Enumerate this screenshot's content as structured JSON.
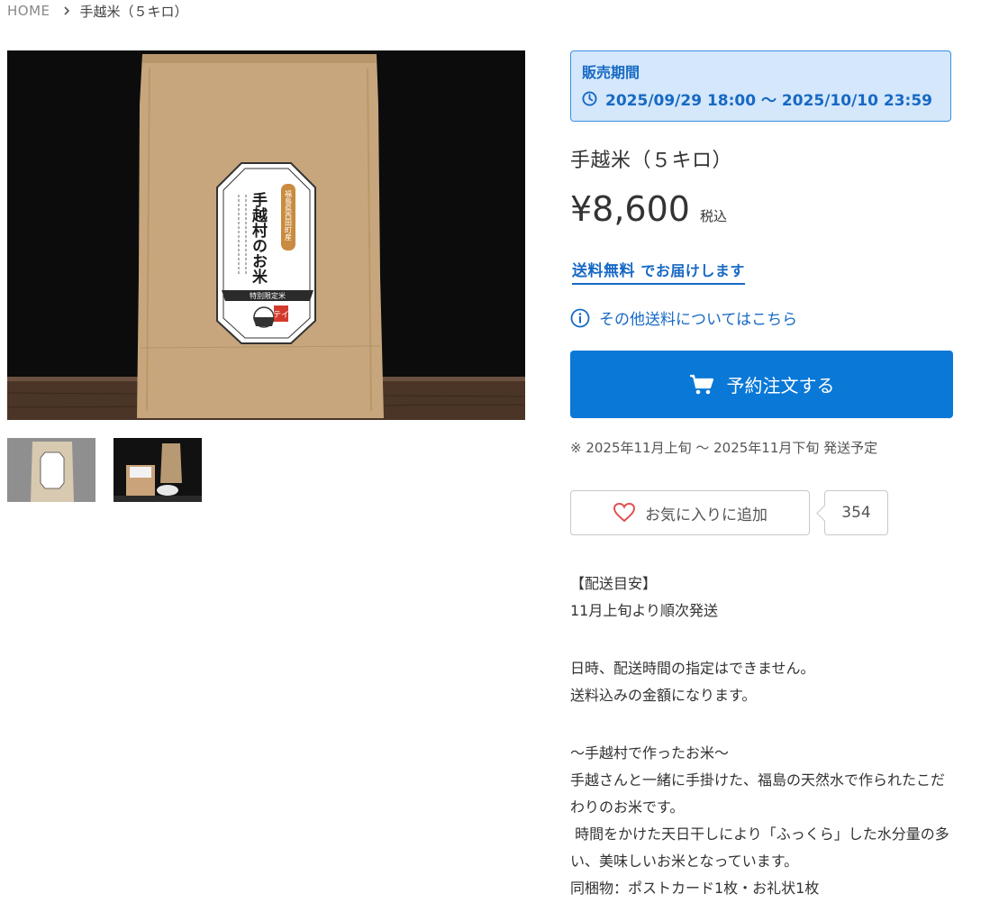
{
  "breadcrumb": {
    "home": "HOME",
    "current": "手越米（５キロ）"
  },
  "main_image": {
    "bag_text": {
      "title": "手越村のお米",
      "origin_label": "福島県西田町産",
      "ribbon": "特別限定米",
      "logo": "テイ"
    }
  },
  "sale_period": {
    "label": "販売期間",
    "dates": "2025/09/29 18:00 〜 2025/10/10 23:59"
  },
  "product": {
    "title": "手越米（５キロ）",
    "price": "¥8,600",
    "tax_label": "税込"
  },
  "shipping": {
    "free_bold": "送料無料",
    "free_rest": "でお届けします",
    "other_link": "その他送料についてはこちら"
  },
  "order_button": {
    "label": "予約注文する"
  },
  "ship_note": "※ 2025年11月上旬 ～ 2025年11月下旬 発送予定",
  "favorite": {
    "label": "お気に入りに追加",
    "count": "354"
  },
  "description": {
    "heading": "【配送目安】",
    "line1": "11月上旬より順次発送",
    "line2": "日時、配送時間の指定はできません。",
    "line3": "送料込みの金額になります。",
    "line4": "〜手越村で作ったお米〜",
    "line5": "手越さんと一緒に手掛けた、福島の天然水で作られたこだ",
    "line6": "わりのお米です。",
    "line7": " 時間をかけた天日干しにより「ふっくら」した水分量の多",
    "line8": "い、美味しいお米となっています。",
    "line9": "同梱物：ポストカード1枚・お礼状1枚"
  },
  "icons": {
    "breadcrumb_separator": "chevron-right-icon",
    "sale_period": "clock-icon",
    "shipping_info": "info-icon",
    "order": "cart-icon",
    "favorite": "heart-icon"
  },
  "colors": {
    "accent": "#0a78d6",
    "link": "#1769c4",
    "sale_bg": "#d4e7fb",
    "heart": "#e05050"
  }
}
